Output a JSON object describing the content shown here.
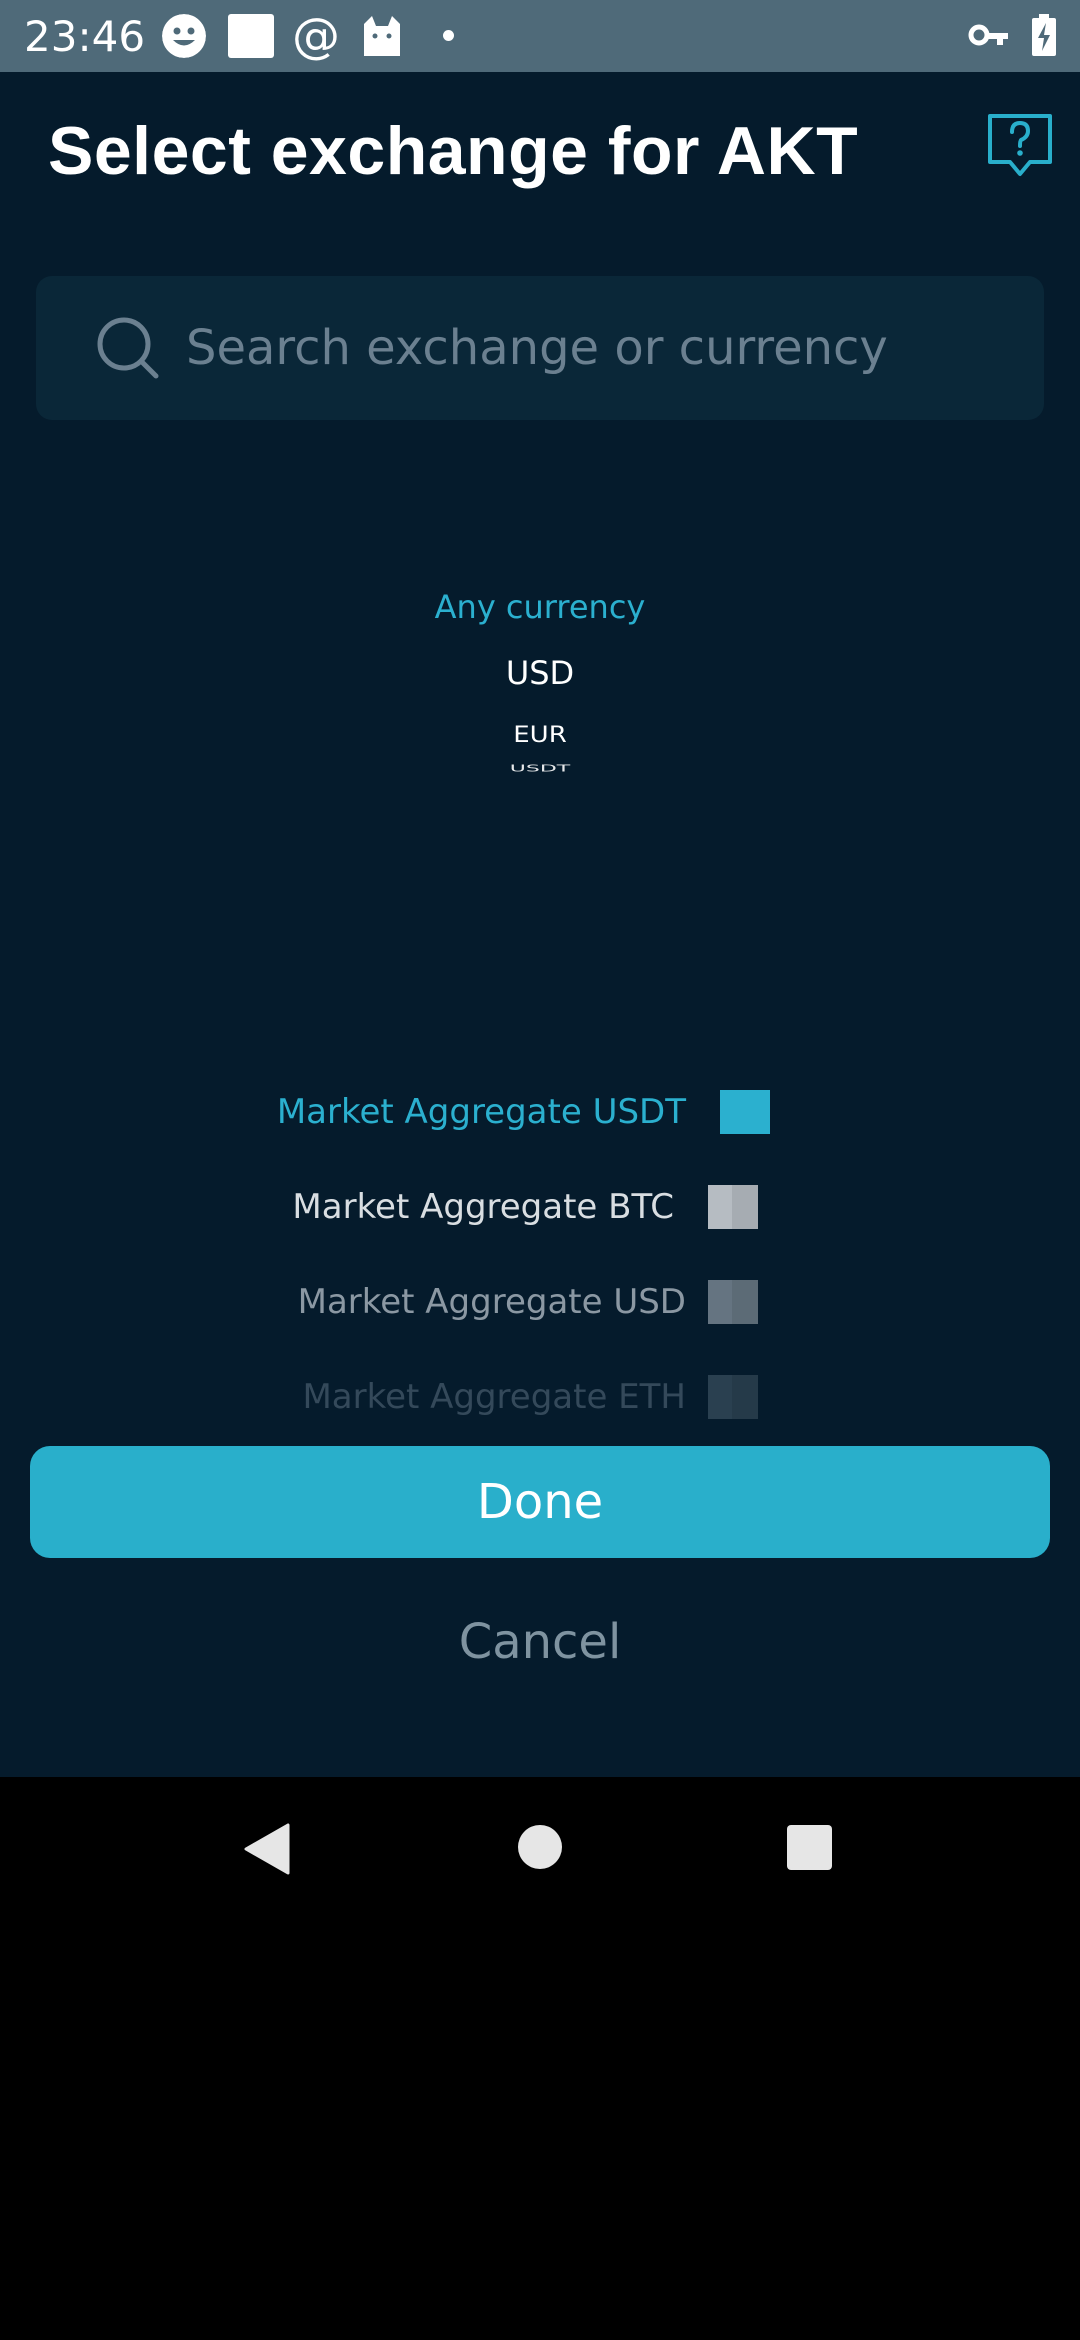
{
  "status_bar": {
    "time": "23:46",
    "icons": [
      "smiley-icon",
      "square-icon",
      "at-sign-icon",
      "cat-icon",
      "dot-icon",
      "vpn-key-icon",
      "battery-charging-icon"
    ]
  },
  "header": {
    "title": "Select exchange for AKT",
    "help_icon": "help-question-icon"
  },
  "search": {
    "placeholder": "Search exchange or currency",
    "value": ""
  },
  "currency_picker": {
    "items": [
      "Any currency",
      "USD",
      "EUR",
      "USDT"
    ],
    "selected": "Any currency"
  },
  "exchange_picker": {
    "items": [
      {
        "label": "Market Aggregate USDT"
      },
      {
        "label": "Market Aggregate BTC"
      },
      {
        "label": "Market Aggregate USD"
      },
      {
        "label": "Market Aggregate ETH"
      }
    ],
    "selected": "Market Aggregate USDT"
  },
  "actions": {
    "done_label": "Done",
    "cancel_label": "Cancel"
  },
  "nav_bar": {
    "icons": [
      "back-icon",
      "home-icon",
      "recents-icon"
    ]
  },
  "colors": {
    "accent": "#29afcb",
    "background": "#051b2c",
    "search_background": "#0a2738",
    "status_bar": "#4f6a79"
  }
}
